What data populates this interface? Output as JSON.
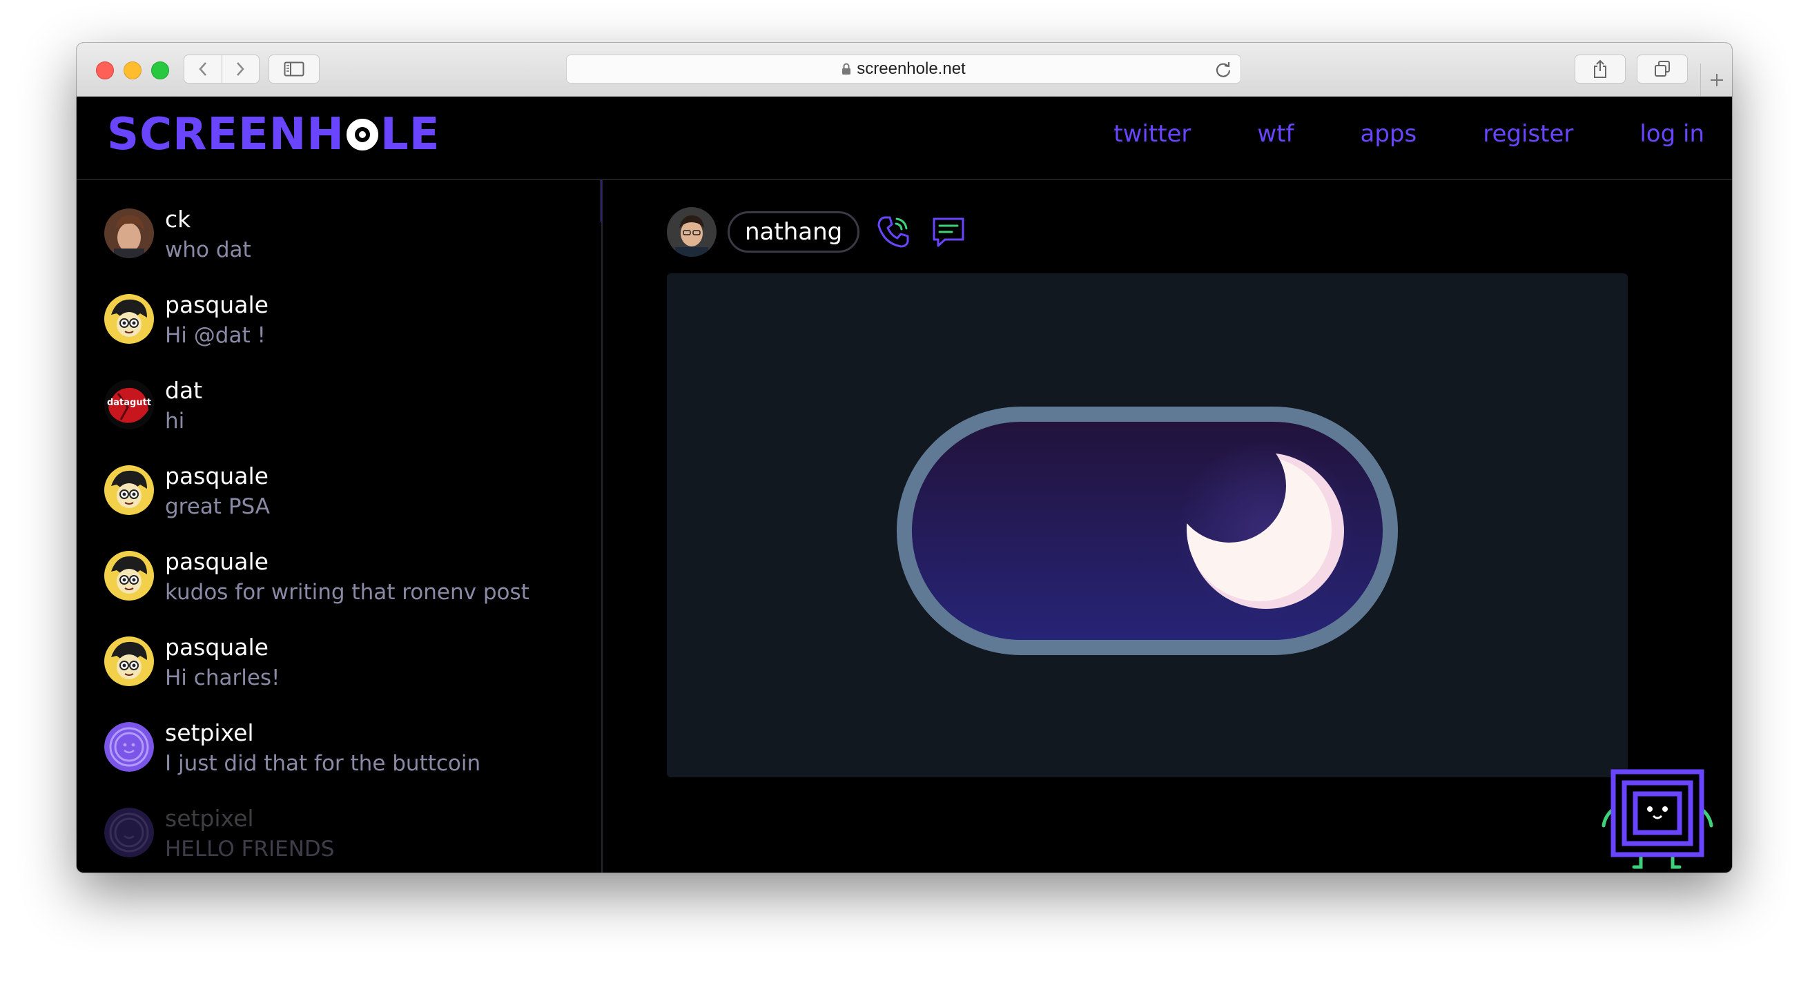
{
  "browser": {
    "url": "screenhole.net",
    "icons": [
      "back-icon",
      "forward-icon",
      "sidebar-icon",
      "lock-icon",
      "reload-icon",
      "share-icon",
      "tabs-icon",
      "new-tab-icon"
    ]
  },
  "site": {
    "logo_text": "SCREENHOLE",
    "accent": "#6a45ff",
    "nav": [
      "twitter",
      "wtf",
      "apps",
      "register",
      "log in"
    ]
  },
  "feed": [
    {
      "user": "ck",
      "message": "who dat"
    },
    {
      "user": "pasquale",
      "message": "Hi @dat !"
    },
    {
      "user": "dat",
      "message": "hi",
      "avatar_text": "datagutt"
    },
    {
      "user": "pasquale",
      "message": "great PSA"
    },
    {
      "user": "pasquale",
      "message": "kudos for writing that ronenv post"
    },
    {
      "user": "pasquale",
      "message": "Hi charles!"
    },
    {
      "user": "setpixel",
      "message": "I just did that for the buttcoin"
    },
    {
      "user": "setpixel",
      "message": "HELLO FRIENDS"
    }
  ],
  "post": {
    "author": "nathang",
    "icons": [
      "phone-icon",
      "chat-icon"
    ],
    "image": "dark-mode-toggle-moon"
  }
}
